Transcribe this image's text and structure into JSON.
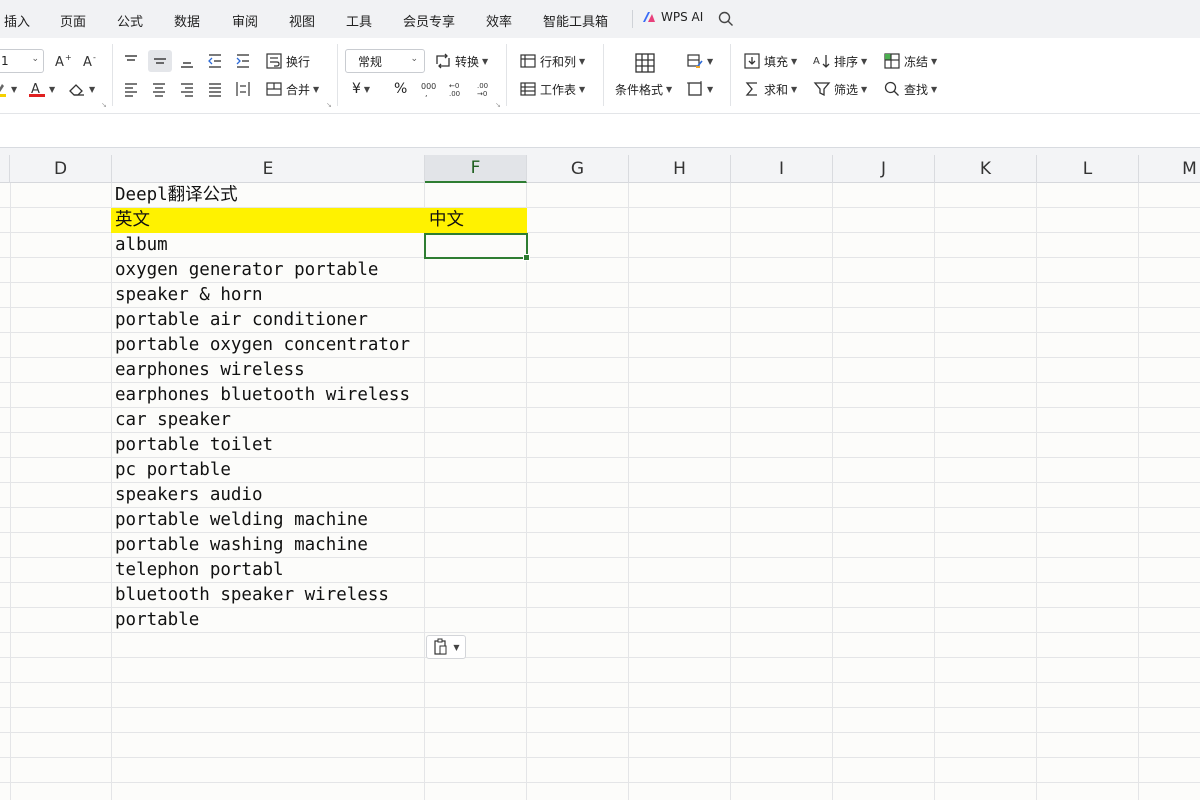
{
  "menu": {
    "tabs": [
      "插入",
      "页面",
      "公式",
      "数据",
      "审阅",
      "视图",
      "工具",
      "会员专享",
      "效率",
      "智能工具箱"
    ],
    "ai_label": "WPS AI"
  },
  "ribbon": {
    "font_size": "1",
    "wrap_text": "换行",
    "merge": "合并",
    "number_format": "常规",
    "convert": "转换",
    "rows_cols": "行和列",
    "worksheet": "工作表",
    "conditional_format": "条件格式",
    "fill": "填充",
    "sort": "排序",
    "freeze": "冻结",
    "sum": "求和",
    "filter": "筛选",
    "find": "查找",
    "currency_symbol": "¥",
    "percent_symbol": "%",
    "font_color_accent": "#e02020",
    "highlight_accent": "#f5d000"
  },
  "grid": {
    "columns": [
      "D",
      "E",
      "F",
      "G",
      "H",
      "I",
      "J",
      "K",
      "L",
      "M"
    ],
    "selected_column": "F",
    "title": "Deepl翻译公式",
    "header_en": "英文",
    "header_zh": "中文",
    "header_fill": "#fff200",
    "selection_color": "#2e7d32",
    "items": [
      "album",
      "oxygen generator portable",
      "speaker & horn",
      "portable air conditioner",
      "portable oxygen concentrator",
      "earphones wireless",
      "earphones bluetooth wireless",
      "car speaker",
      "portable toilet",
      "pc portable",
      "speakers audio",
      "portable welding machine",
      "portable washing machine",
      "telephon portabl",
      "bluetooth speaker wireless",
      "portable"
    ]
  }
}
